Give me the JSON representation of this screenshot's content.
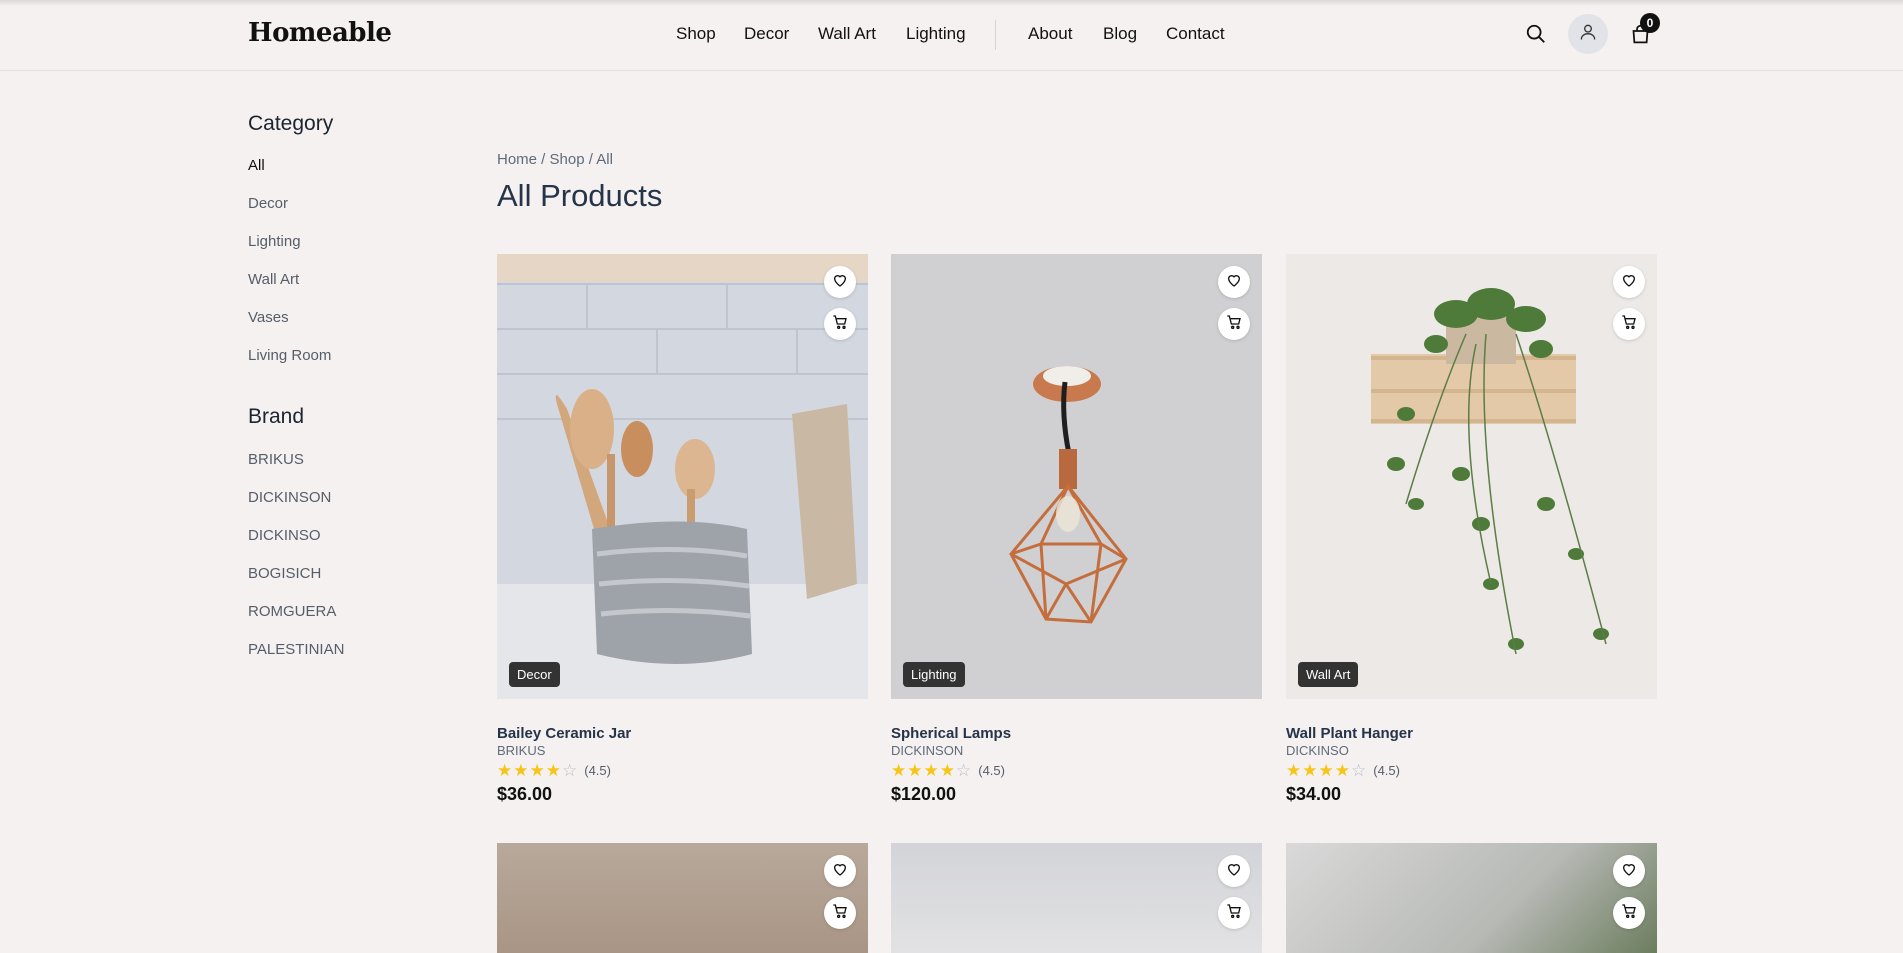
{
  "header": {
    "logo": "Homeable",
    "nav": [
      "Shop",
      "Decor",
      "Wall Art",
      "Lighting",
      "About",
      "Blog",
      "Contact"
    ],
    "cart_count": "0",
    "icons": [
      "search-icon",
      "user-icon",
      "shopping-bag-icon"
    ]
  },
  "sidebar": {
    "category_heading": "Category",
    "categories": [
      "All",
      "Decor",
      "Lighting",
      "Wall Art",
      "Vases",
      "Living Room"
    ],
    "brand_heading": "Brand",
    "brands": [
      "BRIKUS",
      "DICKINSON",
      "DICKINSO",
      "BOGISICH",
      "ROMGUERA",
      "PALESTINIAN"
    ]
  },
  "breadcrumb": [
    "Home",
    "Shop",
    "All"
  ],
  "page_title": "All Products",
  "products": [
    {
      "name": "Bailey Ceramic Jar",
      "brand": "BRIKUS",
      "category": "Decor",
      "rating_text": "(4.5)",
      "rating": 4.5,
      "price": "$36.00"
    },
    {
      "name": "Spherical Lamps",
      "brand": "DICKINSON",
      "category": "Lighting",
      "rating_text": "(4.5)",
      "rating": 4.5,
      "price": "$120.00"
    },
    {
      "name": "Wall Plant Hanger",
      "brand": "DICKINSO",
      "category": "Wall Art",
      "rating_text": "(4.5)",
      "rating": 4.5,
      "price": "$34.00"
    }
  ],
  "colors": {
    "background": "#f5f1f0",
    "badge": "#333333",
    "star": "#f5c518",
    "title": "#26344a"
  }
}
